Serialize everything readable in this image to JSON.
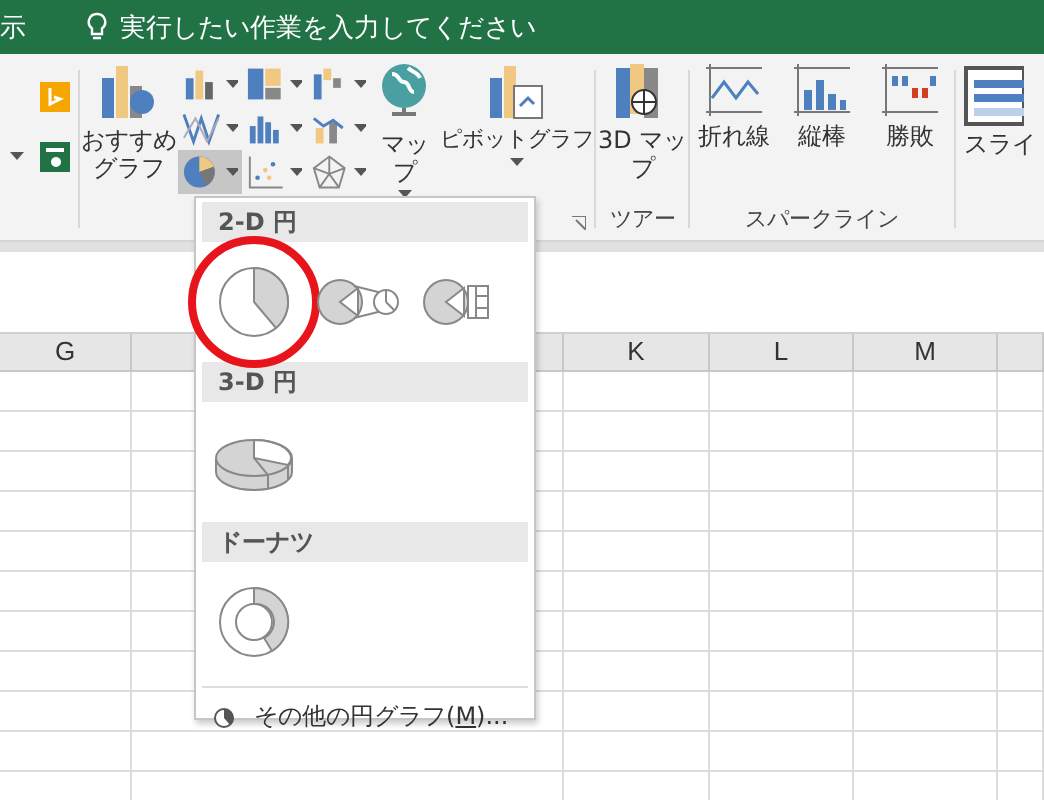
{
  "title_bar": {
    "partial_tab": "示",
    "tell_me": "実行したい作業を入力してください"
  },
  "ribbon": {
    "charts_group": {
      "recommended": "おすすめグラフ",
      "chart_buttons": [
        {
          "kind": "column",
          "selected": false
        },
        {
          "kind": "hierarchy",
          "selected": false
        },
        {
          "kind": "waterfall",
          "selected": false
        },
        {
          "kind": "line",
          "selected": false
        },
        {
          "kind": "statistic",
          "selected": false
        },
        {
          "kind": "combo",
          "selected": false
        },
        {
          "kind": "pie",
          "selected": true
        },
        {
          "kind": "scatter",
          "selected": false
        },
        {
          "kind": "radar",
          "selected": false
        }
      ],
      "maps": "マップ",
      "pivot_chart": "ピボットグラフ"
    },
    "tours_group": {
      "label": "ツアー",
      "button": "3D マップ"
    },
    "sparklines_group": {
      "label": "スパークライン",
      "buttons": [
        {
          "kind": "line",
          "label": "折れ線"
        },
        {
          "kind": "column",
          "label": "縦棒"
        },
        {
          "kind": "win_loss",
          "label": "勝敗"
        }
      ]
    },
    "slicer": "スライ"
  },
  "sheet": {
    "columns": [
      {
        "label": "G"
      },
      {
        "label": "K"
      },
      {
        "label": "L"
      },
      {
        "label": "M"
      }
    ]
  },
  "pie_menu": {
    "sections": [
      {
        "title": "2-D 円",
        "items": [
          {
            "kind": "pie",
            "circled": true
          },
          {
            "kind": "pie_of_pie",
            "circled": false
          },
          {
            "kind": "bar_of_pie",
            "circled": false
          }
        ]
      },
      {
        "title": "3-D 円",
        "items": [
          {
            "kind": "pie_3d",
            "circled": false
          }
        ]
      },
      {
        "title": "ドーナツ",
        "items": [
          {
            "kind": "doughnut",
            "circled": false
          }
        ]
      }
    ],
    "more": {
      "before": "その他の円グラフ(",
      "access_key": "M",
      "after": ")..."
    }
  }
}
